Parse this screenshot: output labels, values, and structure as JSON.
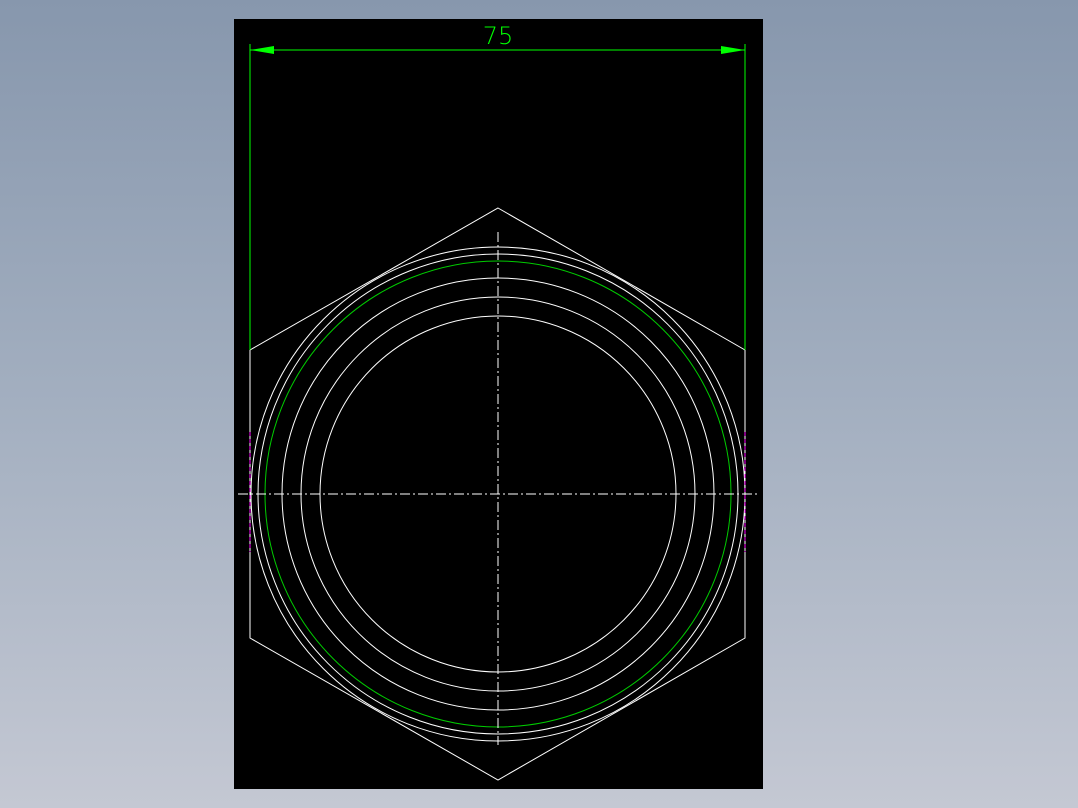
{
  "drawing": {
    "dimension_label": "75"
  },
  "colors": {
    "background_top": "#8797ad",
    "background_bottom": "#c4c8d3",
    "sheet": "#000000",
    "geometry": "#ffffff",
    "dimension": "#00ff00",
    "thread": "#00cc00",
    "hidden_edge": "#ff00ff"
  }
}
